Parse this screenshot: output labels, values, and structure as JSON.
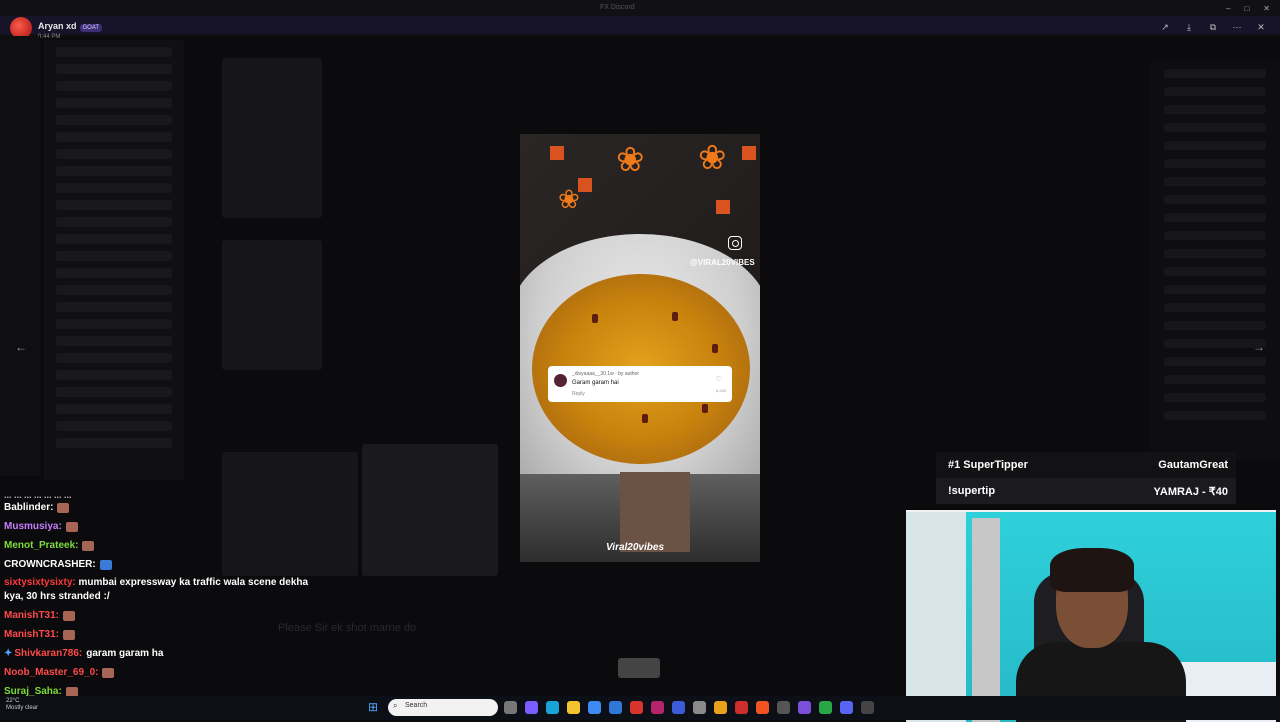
{
  "window": {
    "title": "FX Discord"
  },
  "viewer": {
    "user_name": "Aryan xd",
    "user_badge": "GOAT",
    "user_time": "9:44 PM"
  },
  "media": {
    "ig_handle": "@VIRAL20VIBES",
    "comment_user": "_divyaaaa__30 1w · by author",
    "comment_text": "Garam garam hai",
    "comment_reply": "Reply",
    "comment_likes": "6,240",
    "watermark": "Viral20vibes"
  },
  "tipper": {
    "rank_label": "#1 SuperTipper",
    "rank_name": "GautamGreat",
    "cmd_label": "!supertip",
    "cmd_value": "YAMRAJ - ₹40"
  },
  "chat": {
    "cut_line": "... ... ... ... ... ... ...",
    "messages": [
      {
        "user": "Bablinder:",
        "color": "#ffffff",
        "text": ""
      },
      {
        "user": "Musmusiya:",
        "color": "#c77dff",
        "text": ""
      },
      {
        "user": "Menot_Prateek:",
        "color": "#7ddc3a",
        "text": ""
      },
      {
        "user": "CROWNCRASHER:",
        "color": "#ffffff",
        "text": ""
      },
      {
        "user": "sixtysixtysixty:",
        "color": "#ff3838",
        "text": "mumbai expressway ka traffic wala scene dekha kya, 30 hrs stranded :/"
      },
      {
        "user": "ManishT31:",
        "color": "#ff4a4a",
        "text": ""
      },
      {
        "user": "ManishT31:",
        "color": "#ff4a4a",
        "text": ""
      },
      {
        "user": "Shivkaran786:",
        "color": "#ff4a4a",
        "text": "garam garam ha"
      },
      {
        "user": "Noob_Master_69_0:",
        "color": "#ff4a4a",
        "text": ""
      },
      {
        "user": "Suraj_Saha:",
        "color": "#7ddc3a",
        "text": ""
      }
    ]
  },
  "ghost": {
    "prompt": "Please Sir ek shot marne do"
  },
  "taskbar": {
    "search_placeholder": "Search",
    "weather_temp": "22°C",
    "weather_desc": "Mostly clear"
  }
}
